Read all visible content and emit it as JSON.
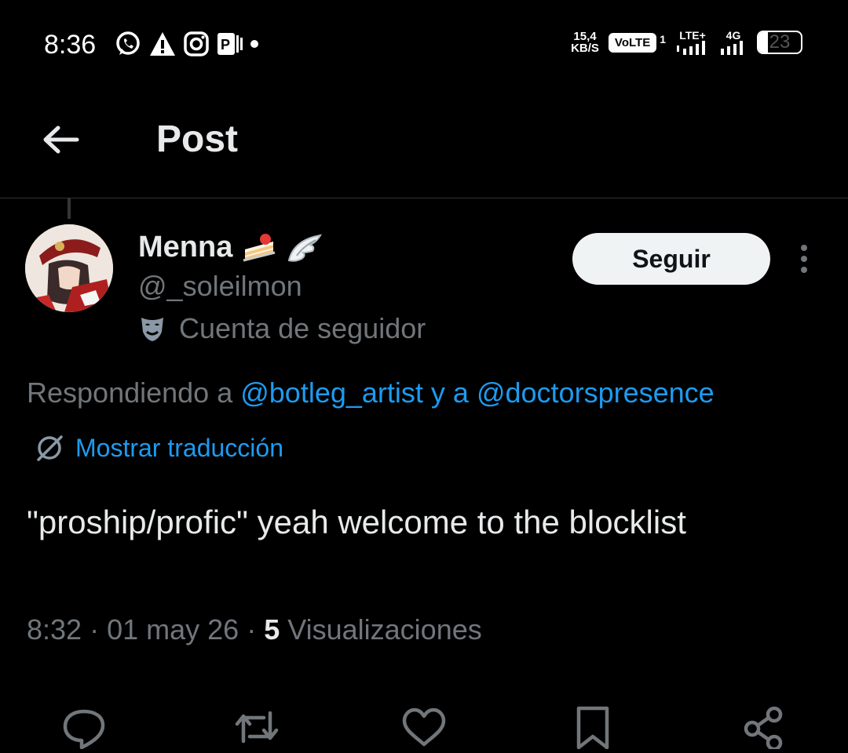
{
  "status_bar": {
    "time": "8:36",
    "speed_value": "15,4",
    "speed_unit": "KB/S",
    "volte": "VoLTE",
    "sim_index": "1",
    "network_1": "LTE+",
    "network_2": "4G",
    "battery": "23",
    "battery_level": 0.23
  },
  "header": {
    "title": "Post"
  },
  "post": {
    "author_name": "Menna",
    "handle": "@_soleilmon",
    "account_label": "Cuenta de seguidor",
    "follow_label": "Seguir",
    "replying_prefix": "Respondiendo a",
    "replying_user_1": "@botleg_artist",
    "replying_joiner": "y a",
    "replying_user_2": "@doctorspresence",
    "translate_label": "Mostrar traducción",
    "text": "\"proship/profic\" yeah welcome to the blocklist",
    "time": "8:32",
    "date": "01 may 26",
    "views_count": "5",
    "views_label": "Visualizaciones"
  },
  "colors": {
    "accent": "#1d9bf0",
    "secondary_text": "#71767b",
    "primary_text": "#e7e9ea"
  },
  "icons": [
    "back-arrow-icon",
    "more-vertical-icon",
    "mask-icon",
    "translate-icon",
    "reply-icon",
    "retweet-icon",
    "like-icon",
    "bookmark-icon",
    "share-icon"
  ]
}
